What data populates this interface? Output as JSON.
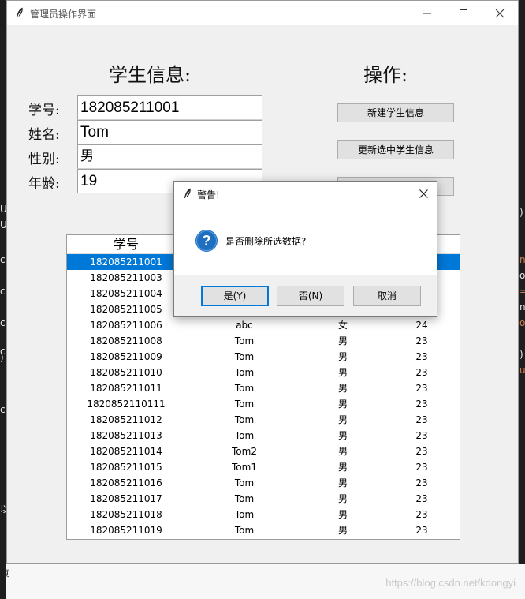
{
  "window": {
    "title": "管理员操作界面"
  },
  "form": {
    "heading": "学生信息:",
    "fields": [
      {
        "label": "学号:",
        "value": "182085211001"
      },
      {
        "label": "姓名:",
        "value": "Tom"
      },
      {
        "label": "性别:",
        "value": "男"
      },
      {
        "label": "年龄:",
        "value": "19"
      }
    ]
  },
  "operations": {
    "heading": "操作:",
    "buttons": [
      "新建学生信息",
      "更新选中学生信息",
      ""
    ]
  },
  "table": {
    "headers": [
      "学号",
      "",
      "",
      ""
    ],
    "selected_index": 0,
    "rows": [
      [
        "182085211001",
        "",
        "",
        ""
      ],
      [
        "182085211003",
        "",
        "",
        ""
      ],
      [
        "182085211004",
        "",
        "",
        ""
      ],
      [
        "182085211005",
        "",
        "",
        ""
      ],
      [
        "182085211006",
        "abc",
        "女",
        "24"
      ],
      [
        "182085211008",
        "Tom",
        "男",
        "23"
      ],
      [
        "182085211009",
        "Tom",
        "男",
        "23"
      ],
      [
        "182085211010",
        "Tom",
        "男",
        "23"
      ],
      [
        "182085211011",
        "Tom",
        "男",
        "23"
      ],
      [
        "1820852110111",
        "Tom",
        "男",
        "23"
      ],
      [
        "182085211012",
        "Tom",
        "男",
        "23"
      ],
      [
        "182085211013",
        "Tom",
        "男",
        "23"
      ],
      [
        "182085211014",
        "Tom2",
        "男",
        "23"
      ],
      [
        "182085211015",
        "Tom1",
        "男",
        "23"
      ],
      [
        "182085211016",
        "Tom",
        "男",
        "23"
      ],
      [
        "182085211017",
        "Tom",
        "男",
        "23"
      ],
      [
        "182085211018",
        "Tom",
        "男",
        "23"
      ],
      [
        "182085211019",
        "Tom",
        "男",
        "23"
      ]
    ]
  },
  "dialog": {
    "title": "警告!",
    "message": "是否删除所选数据?",
    "icon": "question-icon",
    "buttons": {
      "yes": "是(Y)",
      "no": "否(N)",
      "cancel": "取消"
    }
  },
  "background": {
    "left_fragments": [
      "U",
      "U",
      "c",
      "c",
      "c",
      "c",
      ")",
      "c",
      "以",
      "言"
    ],
    "right_fragments": [
      ")",
      "n",
      "o",
      "=",
      "n",
      "o",
      ")",
      "u"
    ],
    "bottom_text": "真",
    "watermark": "https://blog.csdn.net/kdongyi"
  },
  "colors": {
    "selection": "#0078d7",
    "window_bg": "#f0f0f0",
    "button_bg": "#e1e1e1",
    "dialog_default_border": "#0078d7",
    "question_icon": "#1e6fc0"
  }
}
